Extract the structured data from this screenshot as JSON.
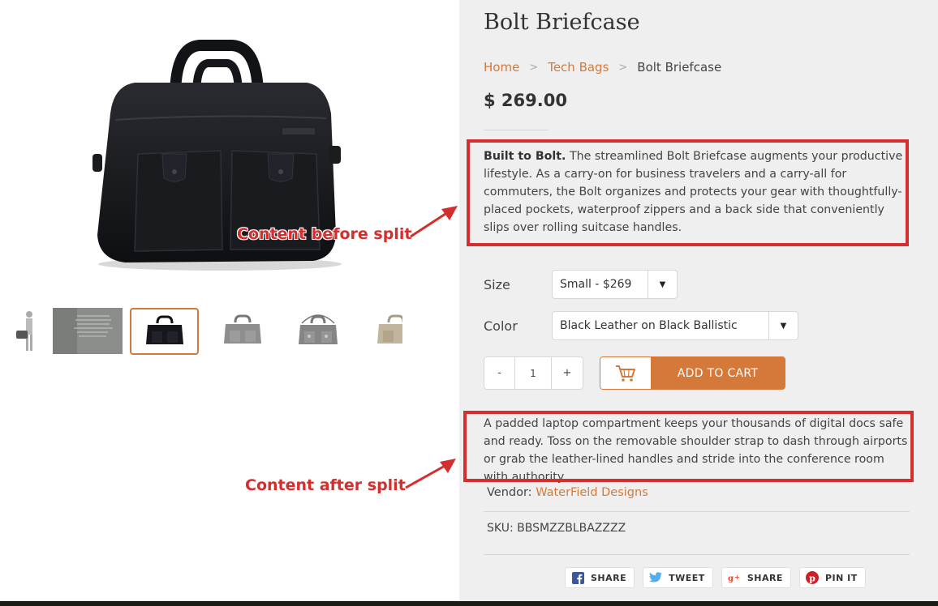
{
  "product": {
    "title": "Bolt Briefcase",
    "price": "$ 269.00",
    "description_lead": "Built to Bolt.",
    "description_before_split": " The streamlined Bolt Briefcase augments your productive lifestyle. As a carry-on for business travelers and a carry-all for commuters, the Bolt organizes and protects your gear with thoughtfully-placed pockets, waterproof zippers and a back side that conveniently slips over rolling suitcase handles.",
    "description_after_split": "A padded laptop compartment keeps your thousands of digital docs safe and ready. Toss on the removable shoulder strap to dash through airports or grab the leather-lined handles and stride into the conference room with authority.",
    "vendor_label": "Vendor:",
    "vendor_name": "WaterField Designs",
    "sku": "SKU: BBSMZZBLBAZZZZ"
  },
  "breadcrumb": {
    "home": "Home",
    "category": "Tech Bags",
    "current": "Bolt Briefcase",
    "separator": ">"
  },
  "options": {
    "size_label": "Size",
    "size_value": "Small - $269",
    "color_label": "Color",
    "color_value": "Black Leather on Black Ballistic",
    "dropdown_arrow": "▼"
  },
  "quantity": {
    "minus": "-",
    "value": "1",
    "plus": "+"
  },
  "cart": {
    "label": "ADD TO CART",
    "icon": "cart-icon"
  },
  "share": [
    {
      "label": "SHARE",
      "icon": "facebook-icon"
    },
    {
      "label": "TWEET",
      "icon": "twitter-icon"
    },
    {
      "label": "SHARE",
      "icon": "google-plus-icon"
    },
    {
      "label": "PIN IT",
      "icon": "pinterest-icon"
    }
  ],
  "annotations": {
    "before": "Content before split",
    "after": "Content after split"
  },
  "thumbnails": [
    {
      "name": "person-with-bag"
    },
    {
      "name": "text-overlay-image"
    },
    {
      "name": "black-briefcase",
      "active": true
    },
    {
      "name": "grey-briefcase"
    },
    {
      "name": "grey-briefcase-strap"
    },
    {
      "name": "tan-briefcase"
    }
  ],
  "colors": {
    "accent": "#d4793a",
    "callout": "#d32f2f",
    "panel_bg": "#efefef"
  }
}
